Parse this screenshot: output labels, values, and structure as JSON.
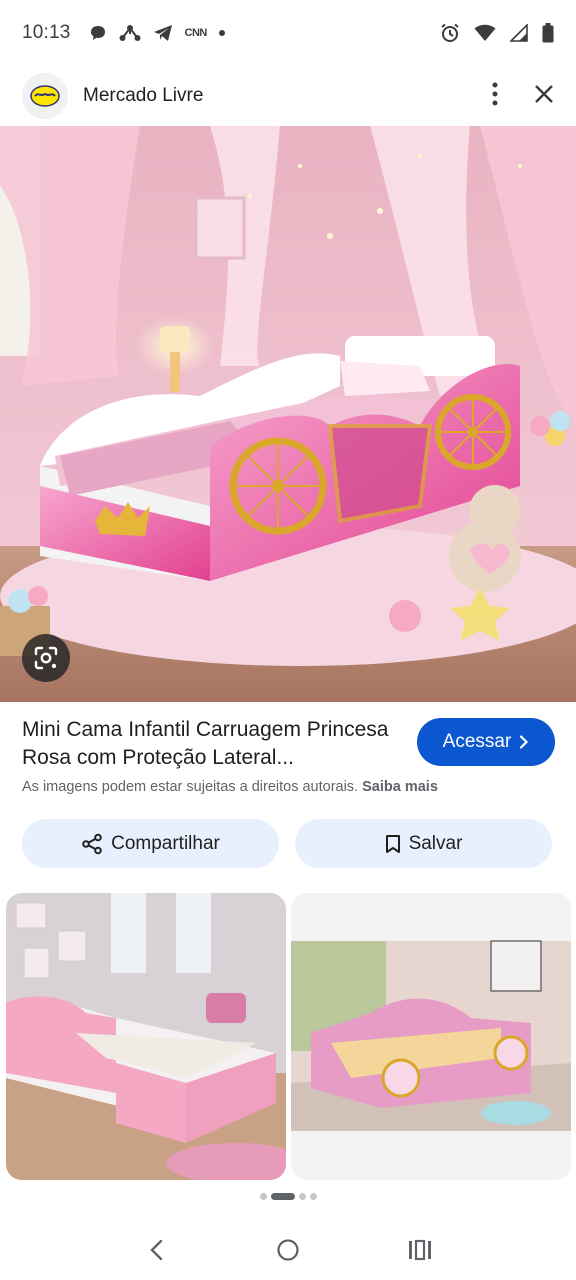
{
  "status_bar": {
    "time": "10:13",
    "notification_icons": [
      "chat-bubble-icon",
      "network-share-icon",
      "telegram-icon",
      "cnn-icon",
      "dot-icon"
    ],
    "cnn_label": "CNN",
    "system_icons": [
      "alarm-icon",
      "wifi-icon",
      "cell-signal-icon",
      "battery-icon"
    ]
  },
  "header": {
    "app_title": "Mercado Livre",
    "menu_icon": "more-vert-icon",
    "close_icon": "close-icon"
  },
  "result": {
    "title": "Mini Cama Infantil Carruagem Princesa Rosa com Proteção Lateral...",
    "visit_label": "Acessar",
    "copyright_text": "As imagens podem estar sujeitas a direitos autorais.",
    "learn_more": "Saiba mais"
  },
  "actions": {
    "share_label": "Compartilhar",
    "save_label": "Salvar"
  },
  "colors": {
    "accent": "#0b57d0",
    "button_bg": "#e8f0fe",
    "pink": "#e2408f"
  },
  "pager": {
    "total": 4,
    "active": 1
  }
}
